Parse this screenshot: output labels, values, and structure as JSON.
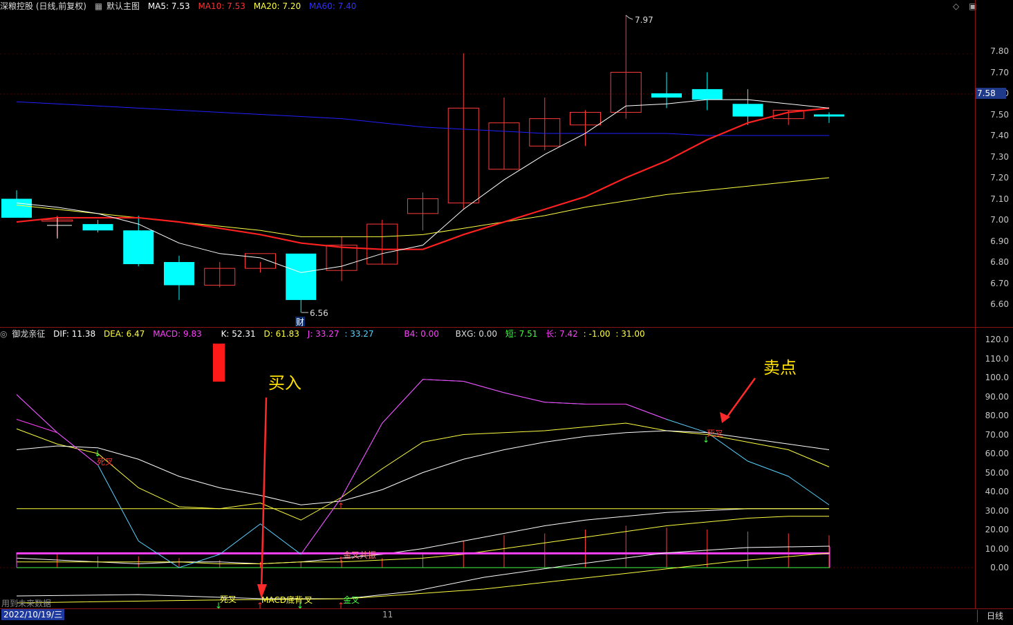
{
  "main_header": {
    "stock": "深粮控股 (日线,前复权)",
    "view": "默认主图",
    "ma5": "MA5: 7.53",
    "ma10": "MA10: 7.53",
    "ma20": "MA20: 7.20",
    "ma60": "MA60: 7.40"
  },
  "sub_header": {
    "indicator": "御龙亲征",
    "dif": "DIF: 11.38",
    "dea": "DEA: 6.47",
    "macd": "MACD: 9.83",
    "k": "K: 52.31",
    "d": "D: 61.83",
    "j": "J: 33.27",
    "j2": ": 33.27",
    "b4": "B4: 0.00",
    "bxg": "BXG: 0.00",
    "short": "短: 7.51",
    "long": "长: 7.42",
    "v1": ": -1.00",
    "v2": ": 31.00"
  },
  "price_axis": [
    "7.80",
    "7.70",
    "7.60",
    "7.50",
    "7.40",
    "7.30",
    "7.20",
    "7.10",
    "7.00",
    "6.90",
    "6.80",
    "6.70",
    "6.60"
  ],
  "current_price": "7.58",
  "indicator_axis": [
    "120.0",
    "110.0",
    "100.0",
    "90.00",
    "80.00",
    "70.00",
    "60.00",
    "50.00",
    "40.00",
    "30.00",
    "20.00",
    "10.00",
    "0.00"
  ],
  "annotations": {
    "high": "7.97",
    "low": "6.56",
    "cai": "财",
    "buy": "买入",
    "sell": "卖点",
    "dead1": "死叉",
    "dead2": "死叉",
    "golden1": "金叉",
    "golden_resonance": "金叉共振",
    "dead_bottom": "死叉",
    "macd_bottom": "MACD底背",
    "golden_bottom": "金叉",
    "cross_text": "叉",
    "month_mark": "11"
  },
  "bottom": {
    "date": "2022/10/19/三",
    "future_note": "用到未来数据",
    "tab": "日线"
  },
  "colors": {
    "up": "#ff3b3b",
    "down": "#00ffff",
    "ma5": "#ffffff",
    "ma10": "#ff2020",
    "ma20": "#ffff40",
    "ma60": "#2020ff",
    "accent_yellow": "#ffe000"
  },
  "chart_data": {
    "type": "candlestick",
    "price": {
      "ylim": [
        6.52,
        8.05
      ],
      "candles": [
        {
          "o": 7.1,
          "h": 7.14,
          "l": 7.08,
          "c": 7.01
        },
        {
          "o": 7.0,
          "h": 7.02,
          "l": 6.92,
          "c": 7.0
        },
        {
          "o": 6.98,
          "h": 7.0,
          "l": 6.94,
          "c": 6.95
        },
        {
          "o": 6.95,
          "h": 7.02,
          "l": 6.78,
          "c": 6.79
        },
        {
          "o": 6.8,
          "h": 6.83,
          "l": 6.62,
          "c": 6.69
        },
        {
          "o": 6.69,
          "h": 6.8,
          "l": 6.68,
          "c": 6.77
        },
        {
          "o": 6.77,
          "h": 6.8,
          "l": 6.75,
          "c": 6.84
        },
        {
          "o": 6.84,
          "h": 6.84,
          "l": 6.56,
          "c": 6.62
        },
        {
          "o": 6.76,
          "h": 6.92,
          "l": 6.71,
          "c": 6.88
        },
        {
          "o": 6.79,
          "h": 7.0,
          "l": 6.79,
          "c": 6.98
        },
        {
          "o": 7.03,
          "h": 7.13,
          "l": 6.95,
          "c": 7.1
        },
        {
          "o": 7.08,
          "h": 7.79,
          "l": 7.05,
          "c": 7.53
        },
        {
          "o": 7.24,
          "h": 7.58,
          "l": 7.24,
          "c": 7.46
        },
        {
          "o": 7.35,
          "h": 7.58,
          "l": 7.33,
          "c": 7.48
        },
        {
          "o": 7.45,
          "h": 7.52,
          "l": 7.35,
          "c": 7.51
        },
        {
          "o": 7.51,
          "h": 7.97,
          "l": 7.48,
          "c": 7.7
        },
        {
          "o": 7.6,
          "h": 7.7,
          "l": 7.53,
          "c": 7.58
        },
        {
          "o": 7.62,
          "h": 7.7,
          "l": 7.52,
          "c": 7.57
        },
        {
          "o": 7.55,
          "h": 7.62,
          "l": 7.45,
          "c": 7.49
        },
        {
          "o": 7.48,
          "h": 7.52,
          "l": 7.45,
          "c": 7.52
        },
        {
          "o": 7.5,
          "h": 7.51,
          "l": 7.46,
          "c": 7.49
        }
      ],
      "ma5": [
        7.08,
        7.06,
        7.03,
        6.98,
        6.89,
        6.84,
        6.82,
        6.75,
        6.78,
        6.84,
        6.88,
        7.05,
        7.19,
        7.31,
        7.41,
        7.54,
        7.55,
        7.57,
        7.57,
        7.55,
        7.53
      ],
      "ma10": [
        6.99,
        7.01,
        7.01,
        7.01,
        6.99,
        6.96,
        6.93,
        6.89,
        6.87,
        6.86,
        6.86,
        6.93,
        6.99,
        7.05,
        7.11,
        7.2,
        7.28,
        7.38,
        7.46,
        7.51,
        7.53
      ],
      "ma20": [
        7.07,
        7.05,
        7.03,
        7.01,
        6.99,
        6.97,
        6.95,
        6.92,
        6.92,
        6.92,
        6.93,
        6.96,
        6.99,
        7.02,
        7.06,
        7.09,
        7.12,
        7.14,
        7.16,
        7.18,
        7.2
      ],
      "ma60": [
        7.56,
        7.55,
        7.54,
        7.53,
        7.52,
        7.51,
        7.5,
        7.49,
        7.48,
        7.46,
        7.44,
        7.43,
        7.42,
        7.41,
        7.41,
        7.41,
        7.41,
        7.4,
        7.4,
        7.4,
        7.4
      ]
    },
    "indicator": {
      "ylim": [
        -20,
        125
      ],
      "k": [
        62,
        64,
        63,
        57,
        48,
        42,
        38,
        33,
        35,
        41,
        50,
        57,
        62,
        66,
        69,
        71,
        72,
        71,
        68,
        65,
        62
      ],
      "d": [
        73,
        65,
        60,
        42,
        32,
        31,
        34,
        25,
        37,
        52,
        66,
        70,
        71,
        72,
        74,
        76,
        72,
        70,
        66,
        62,
        53
      ],
      "j": [
        91,
        71,
        54,
        14,
        0,
        7,
        23,
        7,
        37,
        76,
        99,
        98,
        92,
        87,
        86,
        86,
        78,
        71,
        56,
        48,
        33
      ],
      "line30": [
        31,
        31,
        31,
        31,
        31,
        31,
        31,
        31,
        31,
        31,
        31,
        31,
        31,
        31,
        31,
        31,
        31,
        31,
        31,
        31,
        31
      ],
      "macd_bars": [
        8,
        7,
        6,
        6,
        5,
        4,
        3,
        3,
        4,
        5,
        8,
        14,
        17,
        18,
        20,
        22,
        21,
        20,
        19,
        18,
        17
      ],
      "dif": [
        -15,
        -16,
        -17,
        -18,
        -17,
        -17,
        -18,
        -17,
        -15,
        -13,
        -10,
        -6,
        -2,
        2,
        5,
        7,
        9,
        10,
        11,
        11,
        11
      ],
      "dea": [
        -17,
        -17,
        -17,
        -17,
        -17,
        -18,
        -18,
        -17,
        -17,
        -16,
        -15,
        -13,
        -10,
        -7,
        -4,
        -1,
        2,
        4,
        6,
        7,
        7
      ]
    }
  }
}
